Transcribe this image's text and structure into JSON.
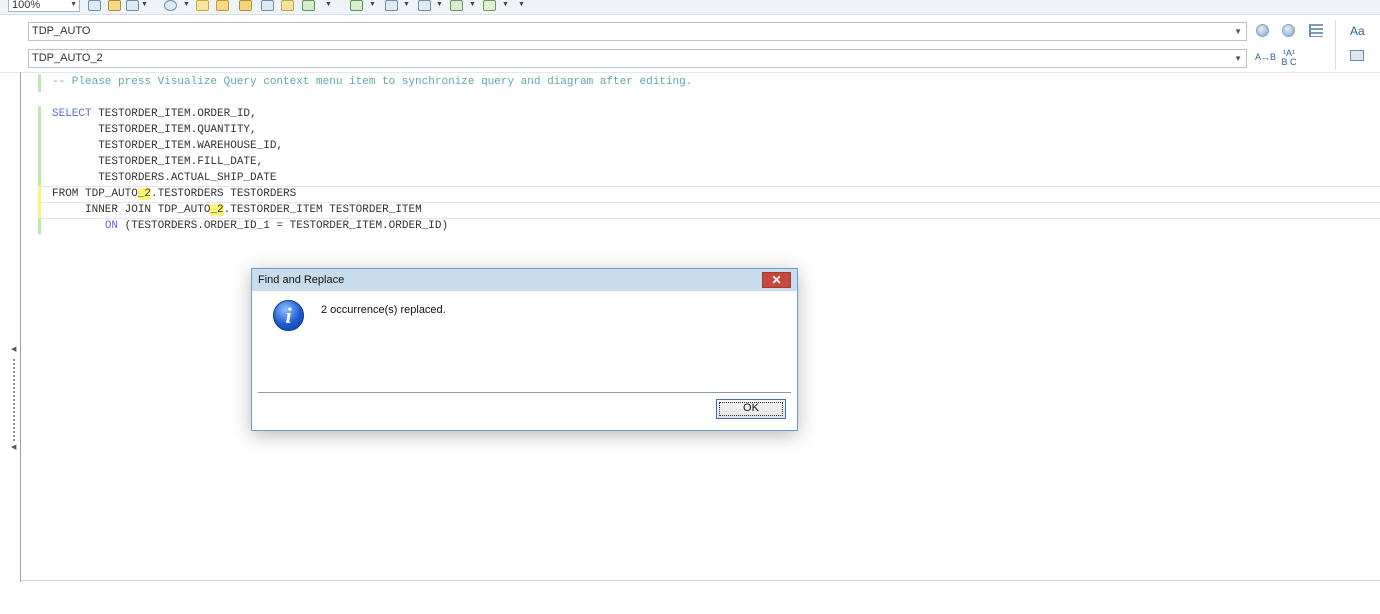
{
  "toolbar": {
    "zoom": "100%"
  },
  "combos": {
    "first": "TDP_AUTO",
    "second": "TDP_AUTO_2"
  },
  "right_tools": {
    "font_label": "Aa",
    "case_label": "A↔B",
    "sort_label": "¹A¹ B C"
  },
  "editor": {
    "comment": "-- Please press Visualize Query context menu item to synchronize query and diagram after editing.",
    "select_kw": "SELECT",
    "select_col1": " TESTORDER_ITEM.ORDER_ID,",
    "col2": "       TESTORDER_ITEM.QUANTITY,",
    "col3": "       TESTORDER_ITEM.WAREHOUSE_ID,",
    "col4": "       TESTORDER_ITEM.FILL_DATE,",
    "col5": "       TESTORDERS.ACTUAL_SHIP_DATE",
    "from_pre": "FROM TDP_AUTO",
    "from_hl": "_2",
    "from_post": ".TESTORDERS TESTORDERS",
    "join_pre": "     INNER JOIN TDP_AUTO",
    "join_hl": "_2",
    "join_post": ".TESTORDER_ITEM TESTORDER_ITEM",
    "on_indent": "        ",
    "on_kw": "ON",
    "on_post": " (TESTORDERS.ORDER_ID_1 = TESTORDER_ITEM.ORDER_ID)"
  },
  "dialog": {
    "title": "Find and Replace",
    "close": "✕",
    "icon_glyph": "i",
    "message": "2 occurrence(s) replaced.",
    "ok": "OK"
  }
}
